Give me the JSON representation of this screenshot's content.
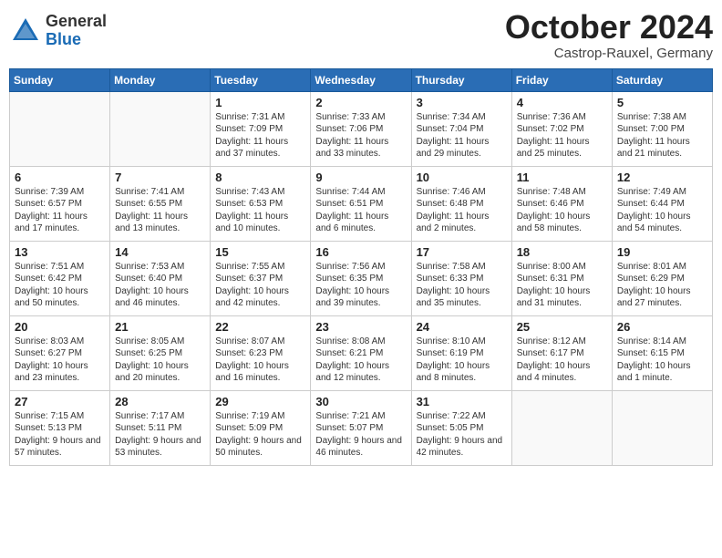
{
  "header": {
    "logo_general": "General",
    "logo_blue": "Blue",
    "month_title": "October 2024",
    "location": "Castrop-Rauxel, Germany"
  },
  "days_of_week": [
    "Sunday",
    "Monday",
    "Tuesday",
    "Wednesday",
    "Thursday",
    "Friday",
    "Saturday"
  ],
  "weeks": [
    [
      {
        "num": "",
        "info": ""
      },
      {
        "num": "",
        "info": ""
      },
      {
        "num": "1",
        "info": "Sunrise: 7:31 AM\nSunset: 7:09 PM\nDaylight: 11 hours and 37 minutes."
      },
      {
        "num": "2",
        "info": "Sunrise: 7:33 AM\nSunset: 7:06 PM\nDaylight: 11 hours and 33 minutes."
      },
      {
        "num": "3",
        "info": "Sunrise: 7:34 AM\nSunset: 7:04 PM\nDaylight: 11 hours and 29 minutes."
      },
      {
        "num": "4",
        "info": "Sunrise: 7:36 AM\nSunset: 7:02 PM\nDaylight: 11 hours and 25 minutes."
      },
      {
        "num": "5",
        "info": "Sunrise: 7:38 AM\nSunset: 7:00 PM\nDaylight: 11 hours and 21 minutes."
      }
    ],
    [
      {
        "num": "6",
        "info": "Sunrise: 7:39 AM\nSunset: 6:57 PM\nDaylight: 11 hours and 17 minutes."
      },
      {
        "num": "7",
        "info": "Sunrise: 7:41 AM\nSunset: 6:55 PM\nDaylight: 11 hours and 13 minutes."
      },
      {
        "num": "8",
        "info": "Sunrise: 7:43 AM\nSunset: 6:53 PM\nDaylight: 11 hours and 10 minutes."
      },
      {
        "num": "9",
        "info": "Sunrise: 7:44 AM\nSunset: 6:51 PM\nDaylight: 11 hours and 6 minutes."
      },
      {
        "num": "10",
        "info": "Sunrise: 7:46 AM\nSunset: 6:48 PM\nDaylight: 11 hours and 2 minutes."
      },
      {
        "num": "11",
        "info": "Sunrise: 7:48 AM\nSunset: 6:46 PM\nDaylight: 10 hours and 58 minutes."
      },
      {
        "num": "12",
        "info": "Sunrise: 7:49 AM\nSunset: 6:44 PM\nDaylight: 10 hours and 54 minutes."
      }
    ],
    [
      {
        "num": "13",
        "info": "Sunrise: 7:51 AM\nSunset: 6:42 PM\nDaylight: 10 hours and 50 minutes."
      },
      {
        "num": "14",
        "info": "Sunrise: 7:53 AM\nSunset: 6:40 PM\nDaylight: 10 hours and 46 minutes."
      },
      {
        "num": "15",
        "info": "Sunrise: 7:55 AM\nSunset: 6:37 PM\nDaylight: 10 hours and 42 minutes."
      },
      {
        "num": "16",
        "info": "Sunrise: 7:56 AM\nSunset: 6:35 PM\nDaylight: 10 hours and 39 minutes."
      },
      {
        "num": "17",
        "info": "Sunrise: 7:58 AM\nSunset: 6:33 PM\nDaylight: 10 hours and 35 minutes."
      },
      {
        "num": "18",
        "info": "Sunrise: 8:00 AM\nSunset: 6:31 PM\nDaylight: 10 hours and 31 minutes."
      },
      {
        "num": "19",
        "info": "Sunrise: 8:01 AM\nSunset: 6:29 PM\nDaylight: 10 hours and 27 minutes."
      }
    ],
    [
      {
        "num": "20",
        "info": "Sunrise: 8:03 AM\nSunset: 6:27 PM\nDaylight: 10 hours and 23 minutes."
      },
      {
        "num": "21",
        "info": "Sunrise: 8:05 AM\nSunset: 6:25 PM\nDaylight: 10 hours and 20 minutes."
      },
      {
        "num": "22",
        "info": "Sunrise: 8:07 AM\nSunset: 6:23 PM\nDaylight: 10 hours and 16 minutes."
      },
      {
        "num": "23",
        "info": "Sunrise: 8:08 AM\nSunset: 6:21 PM\nDaylight: 10 hours and 12 minutes."
      },
      {
        "num": "24",
        "info": "Sunrise: 8:10 AM\nSunset: 6:19 PM\nDaylight: 10 hours and 8 minutes."
      },
      {
        "num": "25",
        "info": "Sunrise: 8:12 AM\nSunset: 6:17 PM\nDaylight: 10 hours and 4 minutes."
      },
      {
        "num": "26",
        "info": "Sunrise: 8:14 AM\nSunset: 6:15 PM\nDaylight: 10 hours and 1 minute."
      }
    ],
    [
      {
        "num": "27",
        "info": "Sunrise: 7:15 AM\nSunset: 5:13 PM\nDaylight: 9 hours and 57 minutes."
      },
      {
        "num": "28",
        "info": "Sunrise: 7:17 AM\nSunset: 5:11 PM\nDaylight: 9 hours and 53 minutes."
      },
      {
        "num": "29",
        "info": "Sunrise: 7:19 AM\nSunset: 5:09 PM\nDaylight: 9 hours and 50 minutes."
      },
      {
        "num": "30",
        "info": "Sunrise: 7:21 AM\nSunset: 5:07 PM\nDaylight: 9 hours and 46 minutes."
      },
      {
        "num": "31",
        "info": "Sunrise: 7:22 AM\nSunset: 5:05 PM\nDaylight: 9 hours and 42 minutes."
      },
      {
        "num": "",
        "info": ""
      },
      {
        "num": "",
        "info": ""
      }
    ]
  ]
}
